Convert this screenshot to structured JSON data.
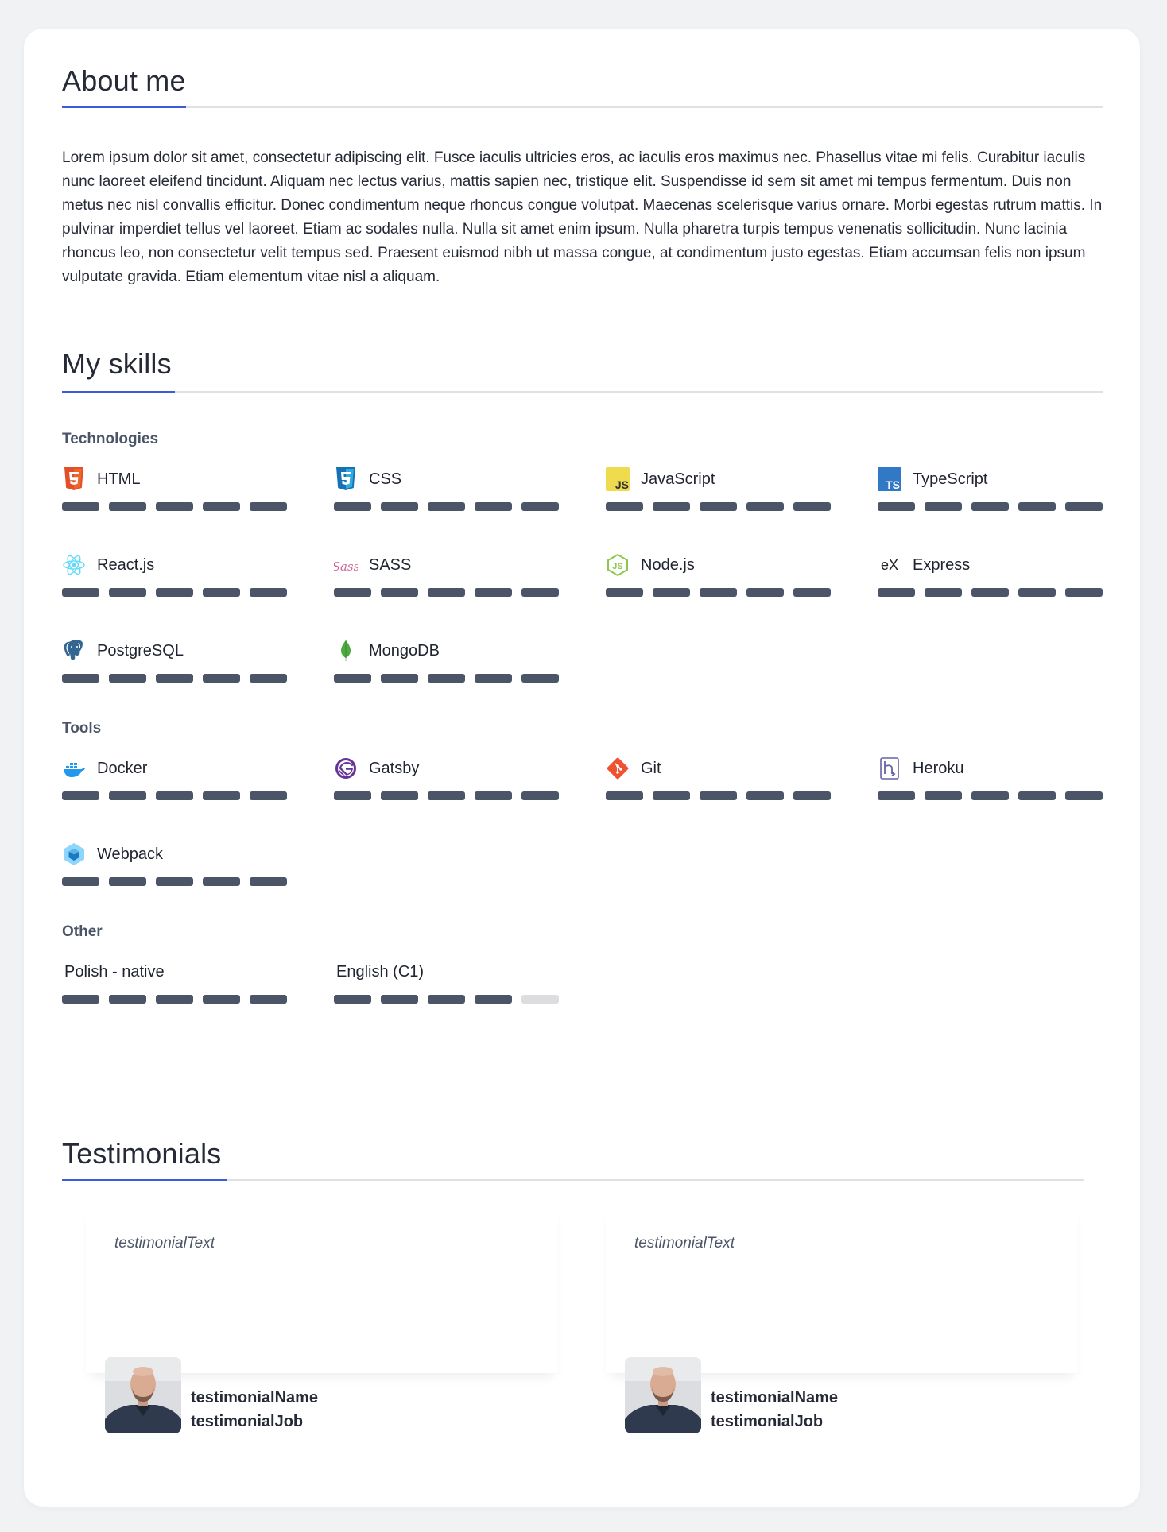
{
  "about": {
    "title": "About me",
    "text": "Lorem ipsum dolor sit amet, consectetur adipiscing elit. Fusce iaculis ultricies eros, ac iaculis eros maximus nec. Phasellus vitae mi felis. Curabitur iaculis nunc laoreet eleifend tincidunt. Aliquam nec lectus varius, mattis sapien nec, tristique elit. Suspendisse id sem sit amet mi tempus fermentum. Duis non metus nec nisl convallis efficitur. Donec condimentum neque rhoncus congue volutpat. Maecenas scelerisque varius ornare. Morbi egestas rutrum mattis. In pulvinar imperdiet tellus vel laoreet. Etiam ac sodales nulla. Nulla sit amet enim ipsum. Nulla pharetra turpis tempus venenatis sollicitudin. Nunc lacinia rhoncus leo, non consectetur velit tempus sed. Praesent euismod nibh ut massa congue, at condimentum justo egestas. Etiam accumsan felis non ipsum vulputate gravida. Etiam elementum vitae nisl a aliquam."
  },
  "skills": {
    "title": "My skills",
    "groups": [
      {
        "label": "Technologies",
        "items": [
          {
            "name": "HTML",
            "icon": "html5-icon",
            "level": 5
          },
          {
            "name": "CSS",
            "icon": "css3-icon",
            "level": 5
          },
          {
            "name": "JavaScript",
            "icon": "javascript-icon",
            "level": 5
          },
          {
            "name": "TypeScript",
            "icon": "typescript-icon",
            "level": 5
          },
          {
            "name": "React.js",
            "icon": "react-icon",
            "level": 5
          },
          {
            "name": "SASS",
            "icon": "sass-icon",
            "level": 5
          },
          {
            "name": "Node.js",
            "icon": "nodejs-icon",
            "level": 5
          },
          {
            "name": "Express",
            "icon": "express-icon",
            "level": 5
          },
          {
            "name": "PostgreSQL",
            "icon": "postgresql-icon",
            "level": 5
          },
          {
            "name": "MongoDB",
            "icon": "mongodb-icon",
            "level": 5
          }
        ]
      },
      {
        "label": "Tools",
        "items": [
          {
            "name": "Docker",
            "icon": "docker-icon",
            "level": 5
          },
          {
            "name": "Gatsby",
            "icon": "gatsby-icon",
            "level": 5
          },
          {
            "name": "Git",
            "icon": "git-icon",
            "level": 5
          },
          {
            "name": "Heroku",
            "icon": "heroku-icon",
            "level": 5
          },
          {
            "name": "Webpack",
            "icon": "webpack-icon",
            "level": 5
          }
        ]
      },
      {
        "label": "Other",
        "items": [
          {
            "name": "Polish - native",
            "icon": "",
            "level": 5
          },
          {
            "name": "English (C1)",
            "icon": "",
            "level": 4
          }
        ]
      }
    ],
    "max_level": 5
  },
  "testimonials": {
    "title": "Testimonials",
    "items": [
      {
        "text": "testimonialText",
        "name": "testimonialName",
        "job": "testimonialJob"
      },
      {
        "text": "testimonialText",
        "name": "testimonialName",
        "job": "testimonialJob"
      }
    ]
  },
  "colors": {
    "accent": "#3d5bd9",
    "bar_on": "#4b5567",
    "bar_off": "#dddde0",
    "background": "#f1f2f4"
  }
}
